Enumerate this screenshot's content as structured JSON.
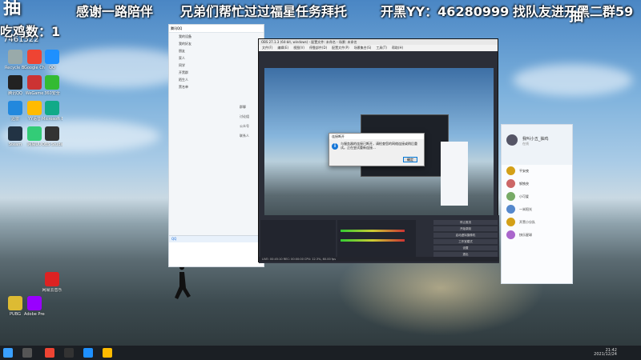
{
  "overlay": {
    "logo": "抽",
    "logo_sub": "7461522",
    "line1_a": "感谢一路陪伴",
    "line1_b": "兄弟们帮忙过过福星任务拜托",
    "line1_c": "开黑YY：46280999",
    "line1_d": "找队友进开黑二群59",
    "line2": "吃鸡数：1",
    "corner": "抽"
  },
  "desktop_icons": [
    {
      "name": "Recycle Bin",
      "color": "#9aa"
    },
    {
      "name": "Google Chrome",
      "color": "#e43"
    },
    {
      "name": "QQ",
      "color": "#1e90ff"
    },
    {
      "name": "腾讯QQ",
      "color": "#222"
    },
    {
      "name": "WeGame",
      "color": "#c33"
    },
    {
      "name": "360安全",
      "color": "#3b3"
    },
    {
      "name": "迅雷",
      "color": "#28d"
    },
    {
      "name": "YY语音",
      "color": "#fb0"
    },
    {
      "name": "Microsoft Edge",
      "color": "#1a8"
    },
    {
      "name": "Steam",
      "color": "#234"
    },
    {
      "name": "网易UU",
      "color": "#3c7"
    },
    {
      "name": "OBS Studio",
      "color": "#333"
    },
    {
      "name": "Adobe Premiere",
      "color": "#90f"
    },
    {
      "name": "PUBG",
      "color": "#db3"
    },
    {
      "name": "网易云音乐",
      "color": "#d22"
    }
  ],
  "qq_main": {
    "title": "腾讯QQ",
    "rows": [
      "我的设备",
      "我的好友",
      "朋友",
      "家人",
      "同学",
      "开黑群",
      "陌生人",
      "黑名单"
    ],
    "groups": [
      "群聊",
      "讨论组",
      "公众号",
      "联系人"
    ]
  },
  "obs": {
    "title": "OBS 27.1.3 (64-bit, windows) - 配置文件: 未命名 - 场景: 未命名",
    "menu": [
      "文件(F)",
      "编辑(E)",
      "视图(V)",
      "停靠部件(D)",
      "配置文件(P)",
      "场景集合(S)",
      "工具(T)",
      "帮助(H)"
    ],
    "panels": [
      "场景",
      "来源",
      "混音器",
      "转场特效",
      "控件"
    ],
    "controls": [
      "停止推流",
      "开始录制",
      "启动虚拟摄像机",
      "工作室模式",
      "设置",
      "退出"
    ],
    "status": "LIVE: 00:45:10   REC: 00:00:00   CPU: 12.3%, 60.00 fps"
  },
  "dialog": {
    "title": "连接断开",
    "message": "与服务器的连接已断开，请检查您的网络连接或稍后重试。正在尝试重新连接…",
    "ok": "确定"
  },
  "chat": {
    "name": "我叫小五_抽鸡",
    "status": "在线",
    "items": [
      "平安夜",
      "钢铁侠",
      "小可爱",
      "一米阳光",
      "开黑小分队",
      "快乐星球"
    ]
  },
  "taskbar": {
    "time": "21:42",
    "date": "2021/12/24"
  }
}
